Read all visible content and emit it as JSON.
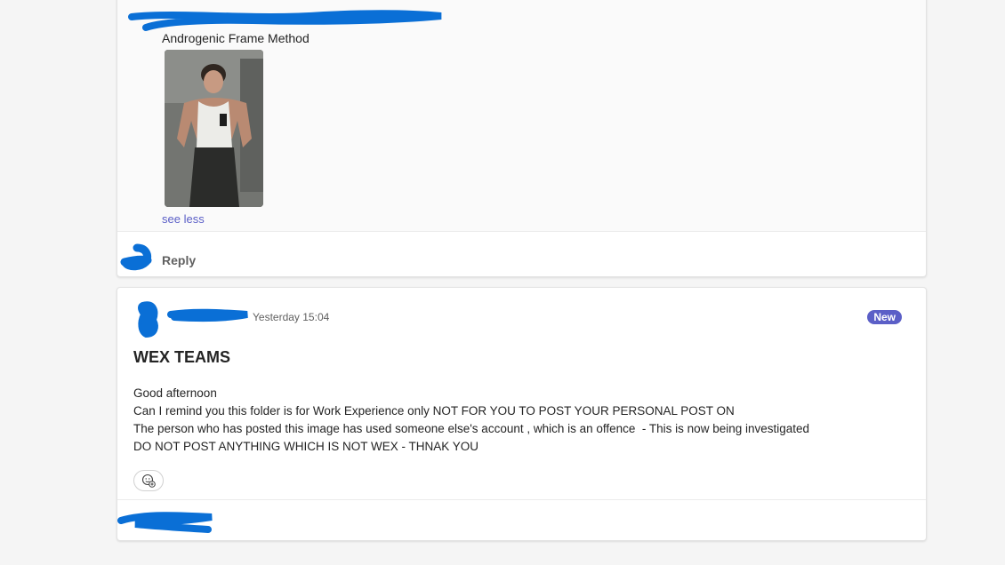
{
  "previous_post": {
    "reply_text": "Androgenic Frame Method",
    "image_alt": "Photo of a man taking a mirror selfie in a white tank top",
    "see_less_label": "see less",
    "reply_label": "Reply"
  },
  "post": {
    "timestamp": "Yesterday 15:04",
    "badge": "New",
    "subject": "WEX TEAMS",
    "body_lines": [
      "Good afternoon",
      "Can I remind you this folder is for Work Experience only NOT FOR YOU TO POST YOUR PERSONAL POST ON",
      "The person who has posted this image has used someone else's account , which is an offence  - This is now being investigated",
      "DO NOT POST ANYTHING WHICH IS NOT WEX - THNAK YOU"
    ]
  },
  "colors": {
    "redaction": "#0a6fd6",
    "accent": "#5b5fc7",
    "page_background": "#f5f5f5"
  },
  "icons": {
    "reaction": "emoji-add-icon"
  }
}
